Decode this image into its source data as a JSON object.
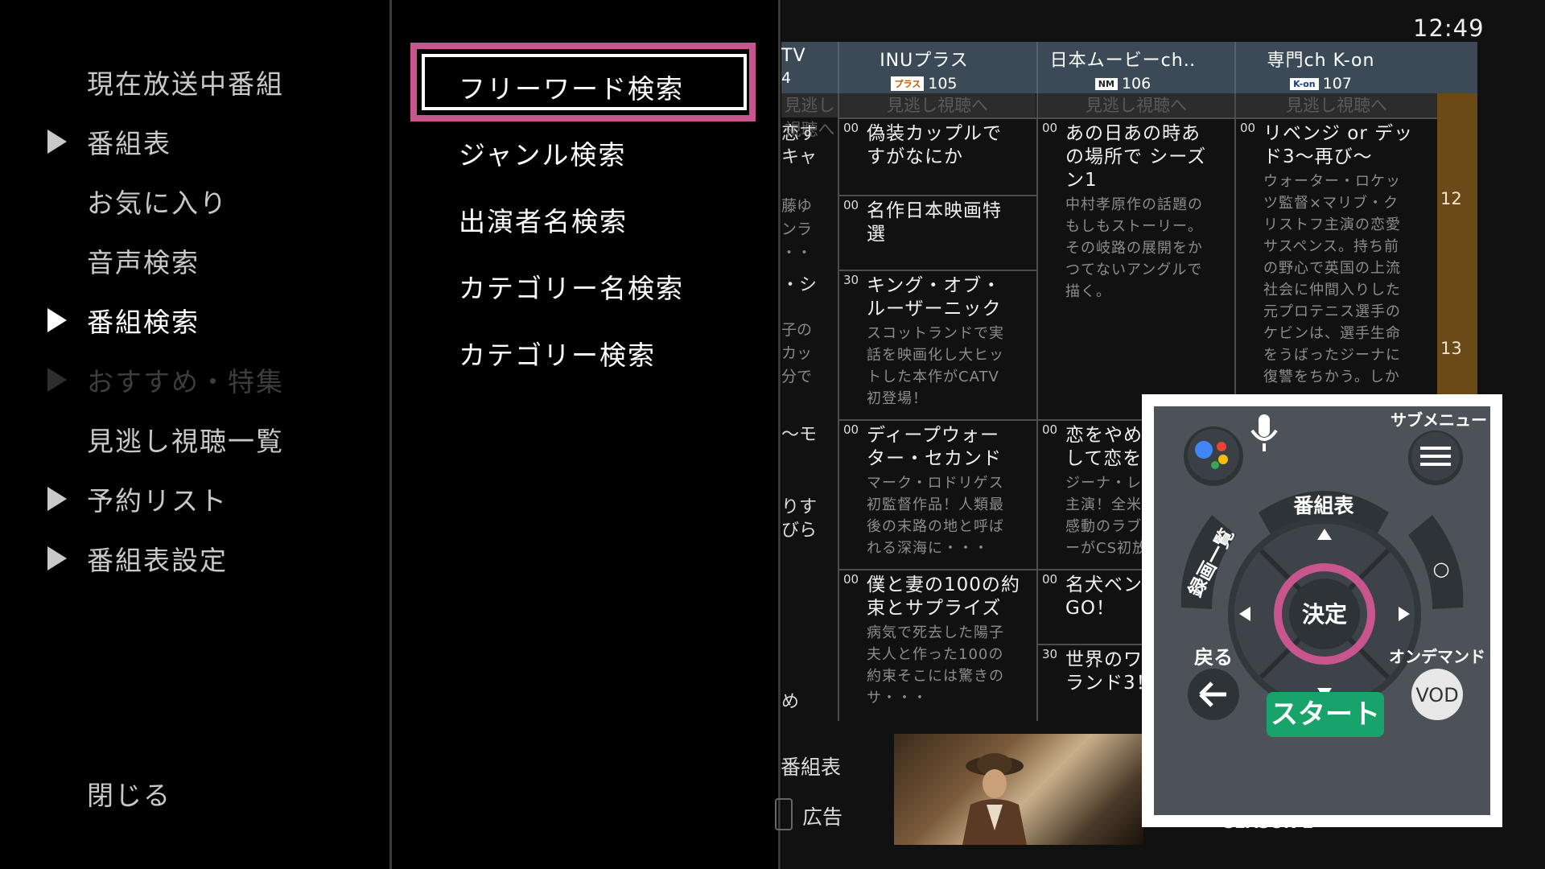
{
  "left_menu": {
    "items": [
      {
        "label": "現在放送中番組",
        "arrow": false,
        "state": "normal"
      },
      {
        "label": "番組表",
        "arrow": true,
        "state": "normal"
      },
      {
        "label": "お気に入り",
        "arrow": false,
        "state": "normal"
      },
      {
        "label": "音声検索",
        "arrow": false,
        "state": "normal"
      },
      {
        "label": "番組検索",
        "arrow": true,
        "state": "active"
      },
      {
        "label": "おすすめ・特集",
        "arrow": true,
        "state": "disabled"
      },
      {
        "label": "見逃し視聴一覧",
        "arrow": false,
        "state": "normal"
      },
      {
        "label": "予約リスト",
        "arrow": true,
        "state": "normal"
      },
      {
        "label": "番組表設定",
        "arrow": true,
        "state": "normal"
      }
    ],
    "close_label": "閉じる"
  },
  "submenu": {
    "items": [
      {
        "label": "フリーワード検索",
        "focused": true
      },
      {
        "label": "ジャンル検索",
        "focused": false
      },
      {
        "label": "出演者名検索",
        "focused": false
      },
      {
        "label": "カテゴリー名検索",
        "focused": false
      },
      {
        "label": "カテゴリー検索",
        "focused": false
      }
    ],
    "focus_color": "#c9558e"
  },
  "epg": {
    "clock": "12:49",
    "channels": [
      {
        "name": "TV",
        "number": "4",
        "logo": ""
      },
      {
        "name": "INUプラス",
        "number": "105",
        "logo": "プラス"
      },
      {
        "name": "日本ムービーch‥",
        "number": "106",
        "logo": "NM"
      },
      {
        "name": "専門ch K-on",
        "number": "107",
        "logo": "K-on"
      }
    ],
    "catchup_label": "見逃し視聴へ",
    "hours": [
      "12",
      "13"
    ],
    "clipped_column": [
      {
        "text": "恋す\nキャ"
      },
      {
        "text": "藤ゆ\nンラ\n・・"
      },
      {
        "text": "・シ"
      },
      {
        "text": "子の\nカッ\n分で"
      },
      {
        "text": "～モ"
      },
      {
        "text": "りす\nびら"
      },
      {
        "text": "め"
      }
    ],
    "programs": {
      "col1": [
        {
          "min": "00",
          "title": "偽装カップルで\nすがなにか",
          "desc": ""
        },
        {
          "min": "00",
          "title": "名作日本映画特\n選",
          "desc": ""
        },
        {
          "min": "30",
          "title": "キング・オブ・\nルーザーニック",
          "desc": "スコットランドで実\n話を映画化し大ヒッ\nトした本作がCATV\n初登場！"
        },
        {
          "min": "00",
          "title": "ディープウォー\nター・セカンド",
          "desc": "マーク・ロドリゲス\n初監督作品！人類最\n後の末路の地と呼ば\nれる深海に・・・"
        },
        {
          "min": "00",
          "title": "僕と妻の100の約\n束とサプライズ",
          "desc": "病気で死去した陽子\n夫人と作った100の\n約束そこには驚きの\nサ・・・"
        }
      ],
      "col2": [
        {
          "min": "00",
          "title": "あの日あの時あ\nの場所で シーズ\nン1",
          "desc": "中村孝原作の話題の\nもしもストーリー。\nその岐路の展開をか\nつてないアングルで\n描く。"
        },
        {
          "min": "00",
          "title": "恋をやめ\nして恋を",
          "desc": "ジーナ・レ\n主演！全米\n感動のラブ\nーがCS初放"
        },
        {
          "min": "00",
          "title": "名犬ベン\nGO！",
          "desc": ""
        },
        {
          "min": "30",
          "title": "世界のワ\nランド3！",
          "desc": ""
        }
      ],
      "col3": [
        {
          "min": "00",
          "title": "リベンジ or デッ\nド3～再び～",
          "desc": "ウォーター・ロケッ\nツ監督×マリブ・ク\nリストフ主演の恋愛\nサスペンス。持ち前\nの野心で英国の上流\n社会に仲間入りした\n元プロテニス選手の\nケビンは、選手生命\nをうばったジーナに\n復讐をちかう。しか"
        }
      ]
    },
    "bottom": {
      "label1": "番組表",
      "label2": "広告",
      "thumb2_text": "SEASON 2"
    }
  },
  "remote": {
    "submenu_label": "サブメニュー",
    "guide_label": "番組表",
    "recorded_label": "録画一覧",
    "ok_label": "決定",
    "back_label": "戻る",
    "ondemand_label": "オンデマンド",
    "vod_label": "VOD",
    "start_label": "スタート",
    "circle_label": "○",
    "highlight_color": "#c9558e",
    "start_color": "#18a36a"
  }
}
